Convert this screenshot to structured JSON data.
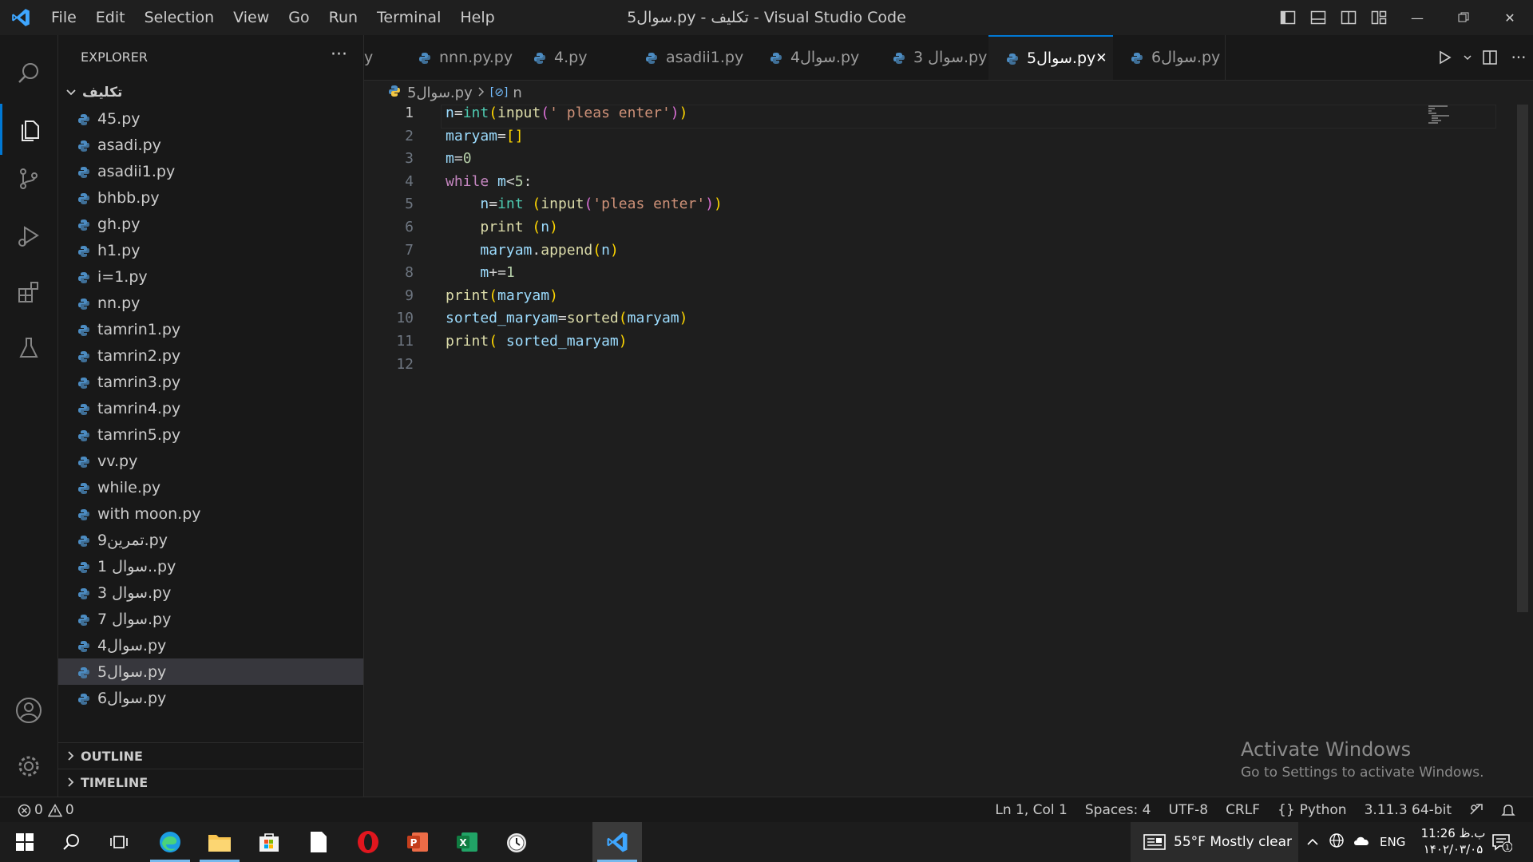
{
  "app": {
    "window_title": "5سوال.py - تکلیف - Visual Studio Code",
    "menu": [
      "File",
      "Edit",
      "Selection",
      "View",
      "Go",
      "Run",
      "Terminal",
      "Help"
    ]
  },
  "sidebar": {
    "title": "EXPLORER",
    "more": "···",
    "folder": "تکلیف",
    "files": [
      "45.py",
      "asadi.py",
      "asadii1.py",
      "bhbb.py",
      "gh.py",
      "h1.py",
      "i=1.py",
      "nn.py",
      "tamrin1.py",
      "tamrin2.py",
      "tamrin3.py",
      "tamrin4.py",
      "tamrin5.py",
      "vv.py",
      "while.py",
      "with moon.py",
      "9تمرین.py",
      "1 سوال..py",
      "3 سوال.py",
      "7 سوال.py",
      "4سوال.py",
      "5سوال.py",
      "6سوال.py"
    ],
    "selected_file": "5سوال.py",
    "outline": "OUTLINE",
    "timeline": "TIMELINE"
  },
  "tabs": {
    "partial": "y",
    "items": [
      "nnn.py.py",
      "4.py",
      "asadii1.py",
      "4سوال.py",
      "3 سوال.py",
      "5سوال.py",
      "6سوال.py"
    ],
    "active": "5سوال.py",
    "close": "✕"
  },
  "breadcrumb": {
    "file": "5سوال.py",
    "symbol": "n"
  },
  "editor": {
    "line_numbers": [
      "1",
      "2",
      "3",
      "4",
      "5",
      "6",
      "7",
      "8",
      "9",
      "10",
      "11",
      "12"
    ],
    "current_line": 1,
    "lines": [
      "n=int(input(' pleas enter'))",
      "maryam=[]",
      "m=0",
      "while m<5:",
      "    n=int (input('pleas enter'))",
      "    print (n)",
      "    maryam.append(n)",
      "    m+=1",
      "print(maryam)",
      "sorted_maryam=sorted(maryam)",
      "print( sorted_maryam)",
      ""
    ]
  },
  "watermark": {
    "title": "Activate Windows",
    "subtitle": "Go to Settings to activate Windows."
  },
  "statusbar": {
    "errors": "0",
    "warnings": "0",
    "position": "Ln 1, Col 1",
    "spaces": "Spaces: 4",
    "encoding": "UTF-8",
    "eol": "CRLF",
    "language": "Python",
    "interpreter": "3.11.3 64-bit"
  },
  "taskbar": {
    "weather": "55°F  Mostly clear",
    "lang": "ENG",
    "time": "11:26 ب.ظ",
    "date": "۱۴۰۲/۰۳/۰۵",
    "notif_count": "1"
  },
  "colors": {
    "accent": "#0078d4",
    "keyword": "#c586c0",
    "function": "#dcdcaa",
    "builtin": "#4ec9b0",
    "variable": "#9cdcfe",
    "string": "#ce9178",
    "number": "#b5cea8"
  }
}
